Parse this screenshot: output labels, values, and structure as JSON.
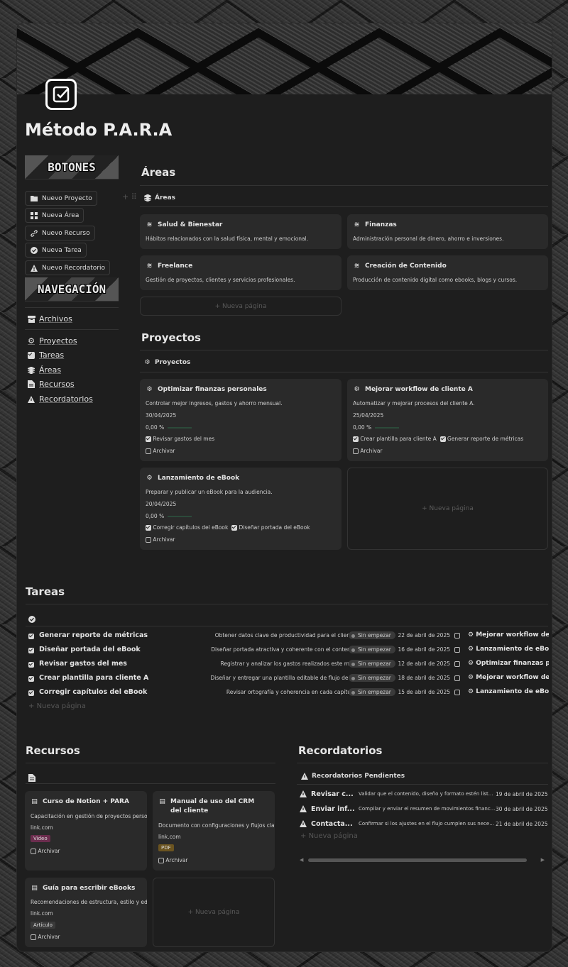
{
  "page": {
    "title": "Método P.A.R.A"
  },
  "sidebar": {
    "buttons_banner": "BOTONES",
    "nav_banner": "NAVEGACIÓN",
    "buttons": [
      {
        "label": "Nuevo Proyecto",
        "icon": "folder-icon"
      },
      {
        "label": "Nueva Área",
        "icon": "grid-icon"
      },
      {
        "label": "Nuevo Recurso",
        "icon": "link-icon"
      },
      {
        "label": "Nueva Tarea",
        "icon": "check-circle-icon"
      },
      {
        "label": "Nuevo Recordatorio",
        "icon": "warning-icon"
      }
    ],
    "archive": "Archivos",
    "nav": [
      {
        "label": "Proyectos",
        "icon": "gear-icon"
      },
      {
        "label": "Tareas",
        "icon": "checkbox-icon"
      },
      {
        "label": "Áreas",
        "icon": "stack-icon"
      },
      {
        "label": "Recursos",
        "icon": "document-icon"
      },
      {
        "label": "Recordatorios",
        "icon": "warning-icon"
      }
    ]
  },
  "areas": {
    "heading": "Áreas",
    "db": "Áreas",
    "cards": [
      {
        "title": "Salud & Bienestar",
        "desc": "Hábitos relacionados con la salud física, mental y emocional."
      },
      {
        "title": "Finanzas",
        "desc": "Administración personal de dinero, ahorro e inversiones."
      },
      {
        "title": "Freelance",
        "desc": "Gestión de proyectos, clientes y servicios profesionales."
      },
      {
        "title": "Creación de Contenido",
        "desc": "Producción de contenido digital como ebooks, blogs y cursos."
      }
    ],
    "new_page": "+ Nueva página"
  },
  "projects": {
    "heading": "Proyectos",
    "db": "Proyectos",
    "cards": [
      {
        "title": "Optimizar finanzas personales",
        "desc": "Controlar mejor ingresos, gastos y ahorro mensual.",
        "date": "30/04/2025",
        "progress": "0,00 %",
        "tasks": [
          "Revisar gastos del mes"
        ],
        "archive": "Archivar"
      },
      {
        "title": "Mejorar workflow de cliente A",
        "desc": "Automatizar y mejorar procesos del cliente A.",
        "date": "25/04/2025",
        "progress": "0,00 %",
        "tasks": [
          "Crear plantilla para cliente A",
          "Generar reporte de métricas"
        ],
        "archive": "Archivar"
      },
      {
        "title": "Lanzamiento de eBook",
        "desc": "Preparar y publicar un eBook para la audiencia.",
        "date": "20/04/2025",
        "progress": "0,00 %",
        "tasks": [
          "Corregir capítulos del eBook",
          "Diseñar portada del eBook"
        ],
        "archive": "Archivar"
      }
    ],
    "new_page": "+ Nueva página"
  },
  "tasks": {
    "heading": "Tareas",
    "rows": [
      {
        "name": "Generar reporte de métricas",
        "desc": "Obtener datos clave de productividad para el cliente.",
        "status": "Sin empezar",
        "date": "22 de abril de 2025",
        "project": "Mejorar workflow de cli"
      },
      {
        "name": "Diseñar portada del eBook",
        "desc": "Diseñar portada atractiva y coherente con el conteni...",
        "status": "Sin empezar",
        "date": "16 de abril de 2025",
        "project": "Lanzamiento de eBook"
      },
      {
        "name": "Revisar gastos del mes",
        "desc": "Registrar y analizar los gastos realizados este mes.",
        "status": "Sin empezar",
        "date": "12 de abril de 2025",
        "project": "Optimizar finanzas pers"
      },
      {
        "name": "Crear plantilla para cliente A",
        "desc": "Diseñar y entregar una plantilla editable de flujo de t...",
        "status": "Sin empezar",
        "date": "18 de abril de 2025",
        "project": "Mejorar workflow de cli"
      },
      {
        "name": "Corregir capítulos del eBook",
        "desc": "Revisar ortografía y coherencia en cada capítulo.",
        "status": "Sin empezar",
        "date": "15 de abril de 2025",
        "project": "Lanzamiento de eBook"
      }
    ],
    "new_page": "Nueva página"
  },
  "resources": {
    "heading": "Recursos",
    "cards": [
      {
        "title": "Curso de Notion + PARA",
        "desc": "Capacitación en gestión de proyectos personale",
        "link": "link.com",
        "tag": "Video",
        "tag_color": "#6b2d4e",
        "archive": "Archivar"
      },
      {
        "title": "Manual de uso del CRM del cliente",
        "desc": "Documento con configuraciones y flujos clave d",
        "link": "link.com",
        "tag": "PDF",
        "tag_color": "#6b5420",
        "archive": "Archivar"
      },
      {
        "title": "Guía para escribir eBooks",
        "desc": "Recomendaciones de estructura, estilo y edición",
        "link": "link.com",
        "tag": "Artículo",
        "tag_color": "#3a3a3a",
        "archive": "Archivar"
      }
    ],
    "new_page": "+ Nueva página"
  },
  "reminders": {
    "heading": "Recordatorios",
    "db": "Recordatorios Pendientes",
    "rows": [
      {
        "name": "Revisar c...",
        "desc": "Validar que el contenido, diseño y formato estén list...",
        "date": "19 de abril de 2025"
      },
      {
        "name": "Enviar inf...",
        "desc": "Compilar y enviar el resumen de movimientos financ...",
        "date": "30 de abril de 2025"
      },
      {
        "name": "Contacta...",
        "desc": "Confirmar si los ajustes en el flujo cumplen sus nece...",
        "date": "21 de abril de 2025"
      }
    ],
    "new_page": "Nueva página"
  }
}
